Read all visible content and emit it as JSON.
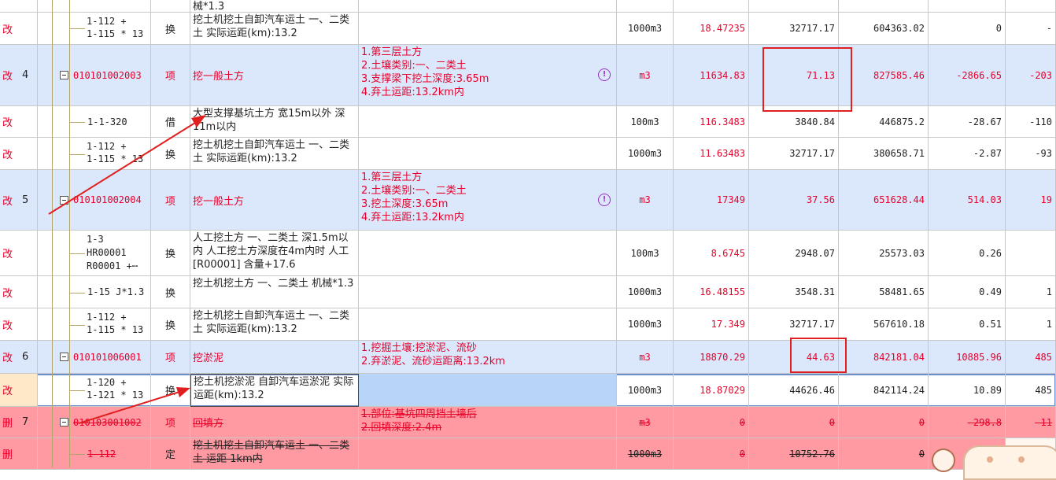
{
  "rows": [
    {
      "status": "",
      "seq": "",
      "code": "",
      "type": "",
      "name": "械*1.3",
      "desc": "",
      "unit": "",
      "qty": "",
      "price": "",
      "total": "",
      "diff": "",
      "extra": ""
    },
    {
      "status": "改",
      "seq": "",
      "code": "1-112 +\n1-115 * 13",
      "type": "换",
      "name": "挖土机挖土自卸汽车运土 一、二类土 实际运距(km):13.2",
      "desc": "",
      "unit": "1000m3",
      "qty": "18.47235",
      "price": "32717.17",
      "total": "604363.02",
      "diff": "0",
      "extra": "-"
    },
    {
      "status": "改",
      "seq": "4",
      "code": "010101002003",
      "type": "项",
      "name": "挖一般土方",
      "desc": "1.第三层土方\n2.土壤类别:一、二类土\n3.支撑梁下挖土深度:3.65m\n4.弃土运距:13.2km内",
      "unit": "m3",
      "qty": "11634.83",
      "price": "71.13",
      "total": "827585.46",
      "diff": "-2866.65",
      "extra": "-203"
    },
    {
      "status": "改",
      "seq": "",
      "code": "1-1-320",
      "type": "借",
      "name": "大型支撑基坑土方 宽15m以外 深11m以内",
      "desc": "",
      "unit": "100m3",
      "qty": "116.3483",
      "price": "3840.84",
      "total": "446875.2",
      "diff": "-28.67",
      "extra": "-110"
    },
    {
      "status": "改",
      "seq": "",
      "code": "1-112 +\n1-115 * 13",
      "type": "换",
      "name": "挖土机挖土自卸汽车运土 一、二类土 实际运距(km):13.2",
      "desc": "",
      "unit": "1000m3",
      "qty": "11.63483",
      "price": "32717.17",
      "total": "380658.71",
      "diff": "-2.87",
      "extra": "-93"
    },
    {
      "status": "改",
      "seq": "5",
      "code": "010101002004",
      "type": "项",
      "name": "挖一般土方",
      "desc": "1.第三层土方\n2.土壤类别:一、二类土\n3.挖土深度:3.65m\n4.弃土运距:13.2km内",
      "unit": "m3",
      "qty": "17349",
      "price": "37.56",
      "total": "651628.44",
      "diff": "514.03",
      "extra": "19"
    },
    {
      "status": "改",
      "seq": "",
      "code": "1-3\nHR00001\nR00001 +⋯",
      "type": "换",
      "name": "人工挖土方 一、二类土 深1.5m以内 人工挖土方深度在4m内时 人工[R00001] 含量+17.6",
      "desc": "",
      "unit": "100m3",
      "qty": "8.6745",
      "price": "2948.07",
      "total": "25573.03",
      "diff": "0.26",
      "extra": ""
    },
    {
      "status": "改",
      "seq": "",
      "code": "1-15 J*1.3",
      "type": "换",
      "name": "挖土机挖土方 一、二类土 机械*1.3",
      "desc": "",
      "unit": "1000m3",
      "qty": "16.48155",
      "price": "3548.31",
      "total": "58481.65",
      "diff": "0.49",
      "extra": "1"
    },
    {
      "status": "改",
      "seq": "",
      "code": "1-112 +\n1-115 * 13",
      "type": "换",
      "name": "挖土机挖土自卸汽车运土 一、二类土 实际运距(km):13.2",
      "desc": "",
      "unit": "1000m3",
      "qty": "17.349",
      "price": "32717.17",
      "total": "567610.18",
      "diff": "0.51",
      "extra": "1"
    },
    {
      "status": "改",
      "seq": "6",
      "code": "010101006001",
      "type": "项",
      "name": "挖淤泥",
      "desc": "1.挖掘土壤:挖淤泥、流砂\n2.弃淤泥、流砂运距离:13.2km",
      "unit": "m3",
      "qty": "18870.29",
      "price": "44.63",
      "total": "842181.04",
      "diff": "10885.96",
      "extra": "485"
    },
    {
      "status": "改",
      "seq": "",
      "code": "1-120 +\n1-121 * 13",
      "type": "换",
      "name": "挖土机挖淤泥 自卸汽车运淤泥 实际运距(km):13.2",
      "desc": "",
      "unit": "1000m3",
      "qty": "18.87029",
      "price": "44626.46",
      "total": "842114.24",
      "diff": "10.89",
      "extra": "485"
    },
    {
      "status": "删",
      "seq": "7",
      "code": "010103001002",
      "type": "项",
      "name": "回填方",
      "desc": "1.部位:基坑四周挡土墙后\n2.回填深度:2.4m",
      "unit": "m3",
      "qty": "0",
      "price": "0",
      "total": "0",
      "diff": "-298.8",
      "extra": "-11"
    },
    {
      "status": "删",
      "seq": "",
      "code": "1-112",
      "type": "定",
      "name": "挖土机挖土自卸汽车运土 一、二类土 运距 1km内",
      "desc": "",
      "unit": "1000m3",
      "qty": "0",
      "price": "10752.76",
      "total": "0",
      "diff": "",
      "extra": ""
    }
  ]
}
